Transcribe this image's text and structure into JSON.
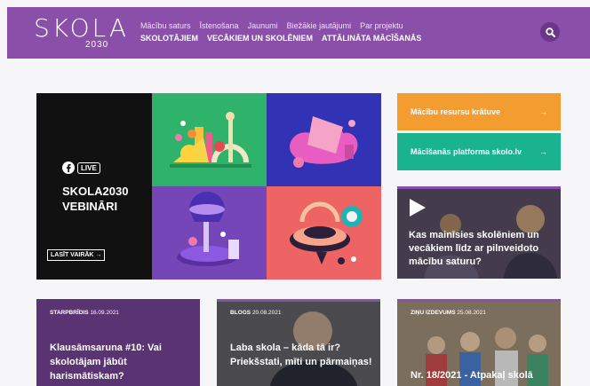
{
  "header": {
    "logo_text": "SKOLA",
    "logo_year": "2030",
    "nav_primary": [
      "Mācību saturs",
      "Īstenošana",
      "Jaunumi",
      "Biežākie jautājumi",
      "Par projektu"
    ],
    "nav_secondary": [
      "SKOLOTĀJIEM",
      "VECĀKIEM UN SKOLĒNIEM",
      "ATTĀLINĀTA MĀCĪŠANĀS"
    ]
  },
  "hero": {
    "live_badge": "LIVE",
    "title_line1": "SKOLA2030",
    "title_line2": "VEBINĀRI",
    "button": "LASĪT VAIRĀK →"
  },
  "side": {
    "cta1": "Mācību resursu krātuve",
    "cta2": "Mācīšanās platforma skolo.lv",
    "arrow": "→",
    "video_title": "Kas mainīsies skolēniem un vecākiem līdz ar pilnveidoto mācību saturu?"
  },
  "cards": [
    {
      "category": "STARPBRĪDIS",
      "date": "16.09.2021",
      "title": "Klausāmsaruna #10: Vai skolotājam jābūt harismātiskam?"
    },
    {
      "category": "BLOGS",
      "date": "20.08.2021",
      "title": "Laba skola – kāda tā ir? Priekšstati, mīti un pārmaiņas!"
    },
    {
      "category": "ZIŅU IZDEVUMS",
      "date": "25.08.2021",
      "title": "Nr. 18/2021 - Atpakaļ skolā"
    }
  ],
  "colors": {
    "brand_purple": "#8a4fa8",
    "orange": "#f39c2f",
    "teal": "#19b38f"
  }
}
